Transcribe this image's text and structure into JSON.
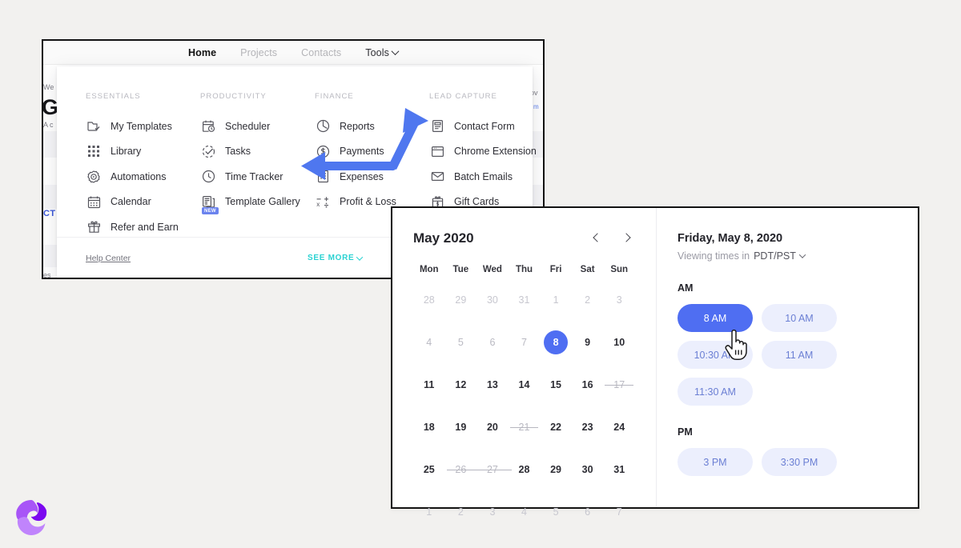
{
  "page": {
    "background_color": "#f2f1ef",
    "accent_blue": "#4f6ef2",
    "accent_teal": "#2ad2d2"
  },
  "app_window": {
    "nav": [
      {
        "label": "Home",
        "active": true
      },
      {
        "label": "Projects",
        "active": false
      },
      {
        "label": "Contacts",
        "active": false
      },
      {
        "label": "Tools",
        "active": false,
        "has_chevron": true
      }
    ],
    "background_text": {
      "left_1": "We",
      "left_big": "G",
      "left_2": "A c",
      "left_cta": "CT",
      "left_3": "es",
      "right_1": "ov",
      "right_2": "m"
    }
  },
  "mega_menu": {
    "columns": [
      {
        "heading": "ESSENTIALS",
        "items": [
          {
            "label": "My Templates",
            "icon": "folder-check-icon"
          },
          {
            "label": "Library",
            "icon": "grid-dots-icon"
          },
          {
            "label": "Automations",
            "icon": "gear-play-icon"
          },
          {
            "label": "Calendar",
            "icon": "calendar-icon"
          },
          {
            "label": "Refer and Earn",
            "icon": "gift-icon"
          }
        ]
      },
      {
        "heading": "PRODUCTIVITY",
        "items": [
          {
            "label": "Scheduler",
            "icon": "calendar-clock-icon"
          },
          {
            "label": "Tasks",
            "icon": "check-circle-dashed-icon"
          },
          {
            "label": "Time Tracker",
            "icon": "clock-icon"
          },
          {
            "label": "Template Gallery",
            "icon": "documents-icon",
            "badge": "NEW"
          }
        ]
      },
      {
        "heading": "FINANCE",
        "items": [
          {
            "label": "Reports",
            "icon": "pie-clock-icon"
          },
          {
            "label": "Payments",
            "icon": "dollar-circle-icon"
          },
          {
            "label": "Expenses",
            "icon": "receipt-icon"
          },
          {
            "label": "Profit & Loss",
            "icon": "math-operators-icon"
          }
        ]
      },
      {
        "heading": "LEAD CAPTURE",
        "items": [
          {
            "label": "Contact Form",
            "icon": "form-icon"
          },
          {
            "label": "Chrome Extension",
            "icon": "browser-window-icon"
          },
          {
            "label": "Batch Emails",
            "icon": "envelope-icon"
          },
          {
            "label": "Gift Cards",
            "icon": "gift-card-icon"
          }
        ]
      }
    ],
    "footer": {
      "help_link": "Help Center",
      "see_more": "SEE MORE"
    }
  },
  "scheduler": {
    "calendar": {
      "month_title": "May 2020",
      "prev_label": "‹",
      "next_label": "›",
      "day_headers": [
        "Mon",
        "Tue",
        "Wed",
        "Thu",
        "Fri",
        "Sat",
        "Sun"
      ],
      "weeks": [
        [
          {
            "n": "28",
            "state": "muted"
          },
          {
            "n": "29",
            "state": "muted"
          },
          {
            "n": "30",
            "state": "muted"
          },
          {
            "n": "31",
            "state": "muted"
          },
          {
            "n": "1",
            "state": "muted"
          },
          {
            "n": "2",
            "state": "muted"
          },
          {
            "n": "3",
            "state": "muted"
          }
        ],
        [
          {
            "n": "4",
            "state": "dim"
          },
          {
            "n": "5",
            "state": "dim"
          },
          {
            "n": "6",
            "state": "dim"
          },
          {
            "n": "7",
            "state": "dim"
          },
          {
            "n": "8",
            "state": "selected"
          },
          {
            "n": "9",
            "state": "normal"
          },
          {
            "n": "10",
            "state": "normal"
          }
        ],
        [
          {
            "n": "11",
            "state": "normal"
          },
          {
            "n": "12",
            "state": "normal"
          },
          {
            "n": "13",
            "state": "normal"
          },
          {
            "n": "14",
            "state": "normal"
          },
          {
            "n": "15",
            "state": "normal"
          },
          {
            "n": "16",
            "state": "normal"
          },
          {
            "n": "17",
            "state": "struck"
          }
        ],
        [
          {
            "n": "18",
            "state": "normal"
          },
          {
            "n": "19",
            "state": "normal"
          },
          {
            "n": "20",
            "state": "normal"
          },
          {
            "n": "21",
            "state": "struck"
          },
          {
            "n": "22",
            "state": "normal"
          },
          {
            "n": "23",
            "state": "normal"
          },
          {
            "n": "24",
            "state": "normal"
          }
        ],
        [
          {
            "n": "25",
            "state": "normal"
          },
          {
            "n": "26",
            "state": "struck-range"
          },
          {
            "n": "27",
            "state": "struck"
          },
          {
            "n": "28",
            "state": "normal"
          },
          {
            "n": "29",
            "state": "normal"
          },
          {
            "n": "30",
            "state": "normal"
          },
          {
            "n": "31",
            "state": "normal"
          }
        ],
        [
          {
            "n": "1",
            "state": "muted"
          },
          {
            "n": "2",
            "state": "muted"
          },
          {
            "n": "3",
            "state": "muted"
          },
          {
            "n": "4",
            "state": "muted"
          },
          {
            "n": "5",
            "state": "muted"
          },
          {
            "n": "6",
            "state": "muted"
          },
          {
            "n": "7",
            "state": "muted"
          }
        ]
      ]
    },
    "slots": {
      "date_title": "Friday, May 8, 2020",
      "timezone_prefix": "Viewing times in",
      "timezone_value": "PDT/PST",
      "am_label": "AM",
      "pm_label": "PM",
      "am_times": [
        {
          "label": "8 AM",
          "selected": true
        },
        {
          "label": "10 AM",
          "selected": false
        },
        {
          "label": "10:30 AM",
          "selected": false
        },
        {
          "label": "11 AM",
          "selected": false
        },
        {
          "label": "11:30 AM",
          "selected": false
        }
      ],
      "pm_times": [
        {
          "label": "3 PM",
          "selected": false
        },
        {
          "label": "3:30 PM",
          "selected": false
        }
      ]
    }
  },
  "annotations": {
    "arrow": {
      "icon": "bent-arrow-annotation",
      "color": "#4f77ef",
      "points_to": [
        "Scheduler",
        "Tools"
      ]
    },
    "cursor": {
      "icon": "hand-pointer-cursor"
    },
    "logo": {
      "icon": "swirl-logo"
    }
  }
}
